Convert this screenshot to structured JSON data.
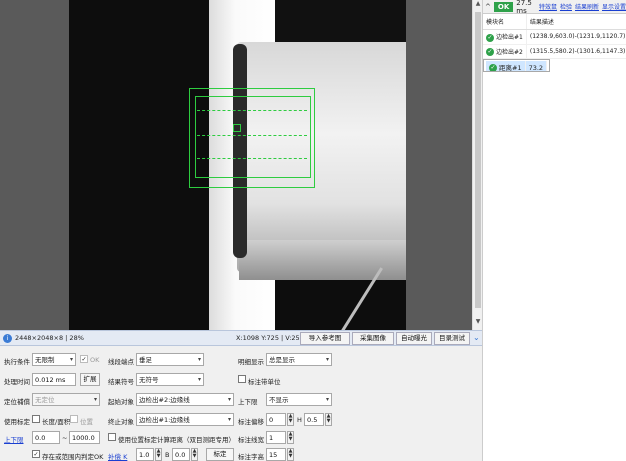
{
  "colors": {
    "ok_green": "#2ea14a",
    "roi_green": "#2ecc40",
    "link_blue": "#1a3fd1",
    "selected_row": "#cfe6ff"
  },
  "panel": {
    "status": "OK",
    "time": "27.5 ms",
    "links": [
      "特效鼠",
      "检验",
      "结果刷新",
      "显示设置"
    ],
    "columns": [
      "模块名",
      "结果描述"
    ],
    "rows": [
      {
        "name": "边检出#1",
        "desc": "(1238.9,603.0)-(1231.9,1120.7)",
        "selected": false,
        "icon": "check-circle-icon"
      },
      {
        "name": "边检出#2",
        "desc": "(1315.5,580.2)-(1301.6,1147.3)",
        "selected": false,
        "icon": "check-circle-icon"
      },
      {
        "name": "距离#1",
        "desc": "73.2",
        "selected": true,
        "icon": "check-circle-icon"
      }
    ]
  },
  "statusbar": {
    "image_info": "2448×2048×8 | 28%",
    "coords": "X:1098 Y:725 | V:255",
    "buttons": [
      "导入参考图",
      "采集图像",
      "自动曝光",
      "目录测试"
    ]
  },
  "controls": {
    "exec_cond_label": "执行条件",
    "exec_cond_value": "无限制",
    "ok_label": "OK",
    "proc_time_label": "处理时间",
    "proc_time_value": "0.012 ms",
    "expand_btn": "扩展",
    "pos_correct_label": "定位補償",
    "pos_correct_value": "无定位",
    "use_calib_label": "使用标定",
    "len_area_label": "长度/面积",
    "pos_label": "位置",
    "upper_lower_link": "上下限",
    "range_min": "0.0",
    "range_sep": "~",
    "range_max": "1000.0",
    "in_range_label": "存在或范围内判定OK",
    "measure_label": "线段端点",
    "measure_value": "垂足",
    "result_sym_label": "结果符号",
    "result_sym_value": "无符号",
    "start_obj_label": "起始对象",
    "start_obj_value": "边检出#2:边缘线",
    "end_obj_label": "终止对象",
    "end_obj_value": "边检出#1:边缘线",
    "use_pos_calib_label": "使用位置标定计算距离（双目测距专用）",
    "comp_k_link": "补偿 K",
    "comp_k_value": "1.0",
    "b_label": "B",
    "b_value": "0.0",
    "calib_btn": "标定",
    "disp_label": "明细显示",
    "disp_value": "总是显示",
    "unit_label": "标注带单位",
    "upper_lower_label": "上下限",
    "upper_lower_value": "不显示",
    "offset_label": "标注偏移",
    "offset_value": "0",
    "h_label": "H",
    "h_value": "0.5",
    "line_width_label": "标注线宽",
    "line_width_value": "1",
    "font_size_label": "标注字高",
    "font_size_value": "15"
  }
}
